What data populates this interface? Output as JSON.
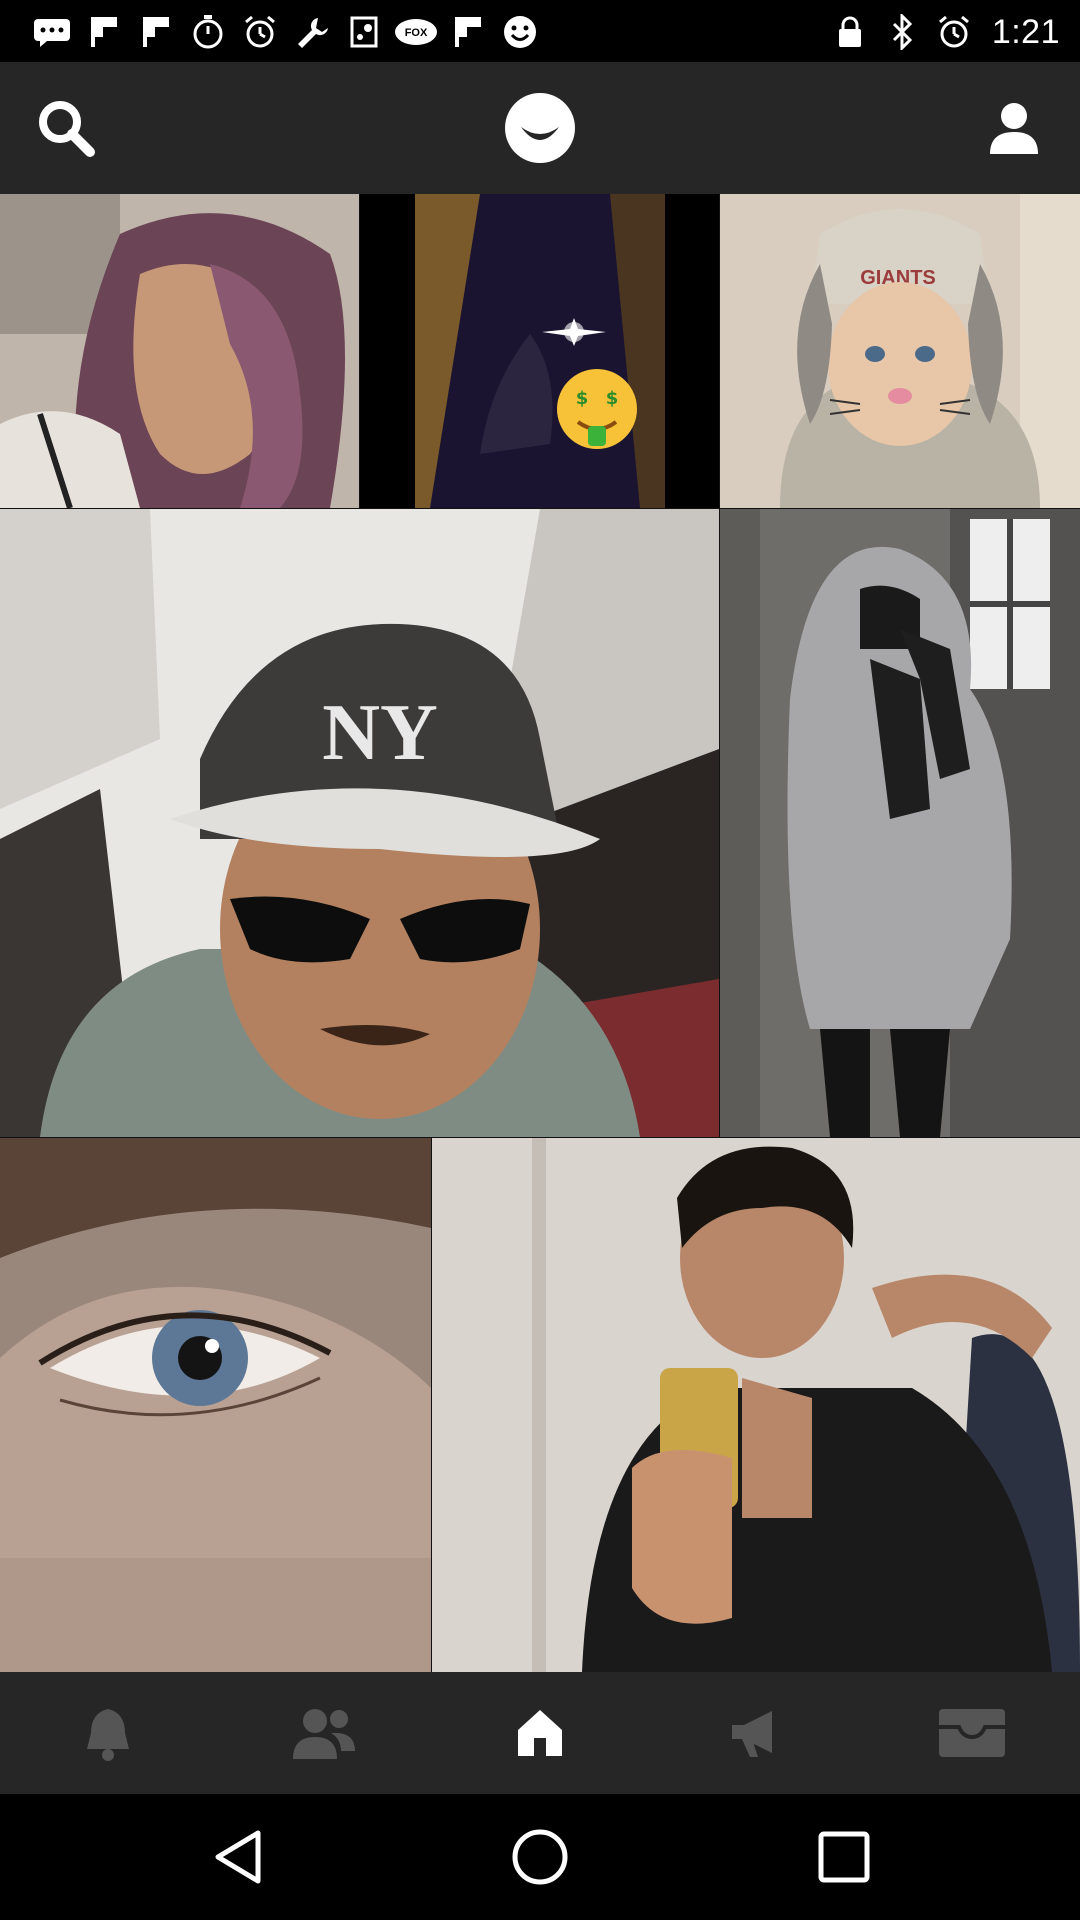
{
  "status_bar": {
    "time": "1:21",
    "left_icons": [
      "message-icon",
      "flipboard-icon",
      "flipboard-icon",
      "stopwatch-icon",
      "alarm-icon",
      "wrench-icon",
      "steam-icon",
      "fox-sports-icon",
      "flipboard-icon",
      "smiley-icon"
    ],
    "right_icons": [
      "lock-icon",
      "bluetooth-icon",
      "alarm-icon"
    ]
  },
  "header": {
    "icons": [
      "search-icon",
      "smile-logo-icon",
      "profile-icon"
    ]
  },
  "grid": {
    "tiles": [
      {
        "name": "photo-tile-1",
        "subject": "woman selfie"
      },
      {
        "name": "photo-tile-2",
        "subject": "dark photo with money emoji"
      },
      {
        "name": "photo-tile-3",
        "subject": "bunny filter selfie"
      },
      {
        "name": "photo-tile-4",
        "subject": "man with cap and sunglasses"
      },
      {
        "name": "photo-tile-5",
        "subject": "person in hoodie"
      },
      {
        "name": "photo-tile-6",
        "subject": "close-up eye"
      },
      {
        "name": "photo-tile-7",
        "subject": "mirror selfie"
      }
    ]
  },
  "bottom_nav": {
    "items": [
      "bell-icon",
      "friends-icon",
      "home-icon",
      "megaphone-icon",
      "inbox-icon"
    ],
    "active": "home-icon",
    "active_color": "#ffffff",
    "inactive_color": "#555555"
  },
  "system_nav": {
    "buttons": [
      "back-icon",
      "home-circle-icon",
      "recents-icon"
    ]
  },
  "colors": {
    "header_bg": "#262626",
    "status_bg": "#000000"
  }
}
